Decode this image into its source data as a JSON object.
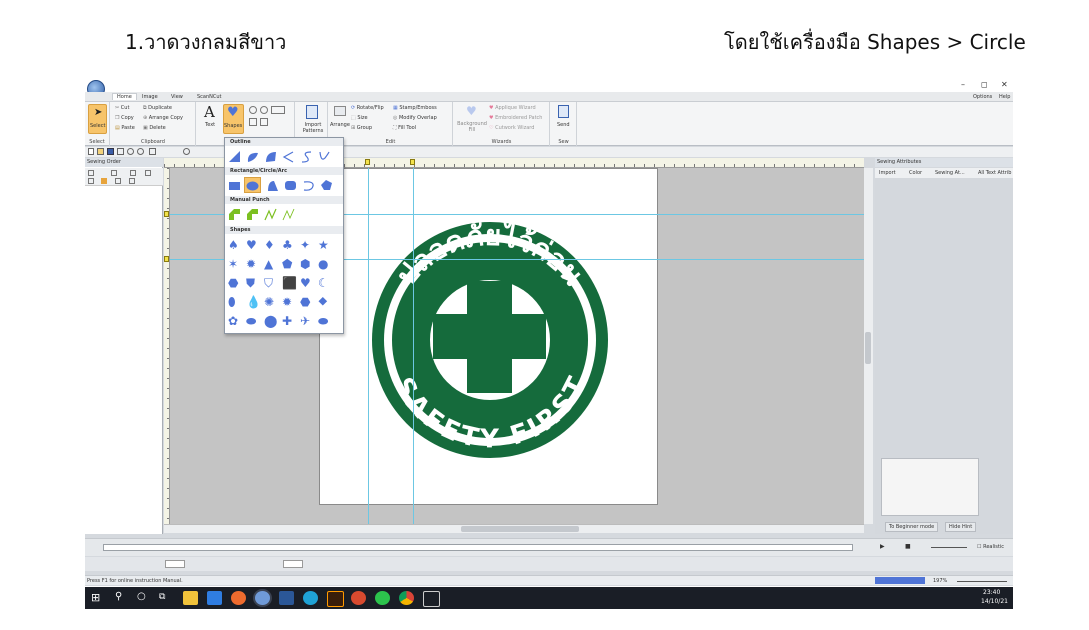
{
  "caption": {
    "left": "1.วาดวงกลมสีขาว",
    "right": "โดยใช้เครื่องมือ Shapes > Circle"
  },
  "window": {
    "minimize_glyph": "–",
    "maximize_glyph": "◻",
    "close_glyph": "✕",
    "options_label": "Options",
    "help_label": "Help"
  },
  "menu": {
    "tabs": [
      "Home",
      "Image",
      "View",
      "ScanNCut"
    ]
  },
  "ribbon": {
    "select_label": "Select",
    "cut_label": "Cut",
    "copy_label": "Copy",
    "paste_label": "Paste",
    "duplicate_label": "Duplicate",
    "arrange_copy_label": "Arrange Copy",
    "delete_label": "Delete",
    "text_label": "Text",
    "shapes_label": "Shapes",
    "import_patterns_label": "Import Patterns",
    "arrange_label": "Arrange",
    "rotate_flip_label": "Rotate/Flip",
    "size_label": "Size",
    "group_label": "Group",
    "stamp_emboss_label": "Stamp/Emboss",
    "modify_overlap_label": "Modify Overlap",
    "fill_tool_label": "Fill Tool",
    "background_fill_label": "Background Fill",
    "applique_wizard_label": "Applique Wizard",
    "embroidered_patch_label": "Embroidered Patch",
    "cutwork_wizard_label": "Cutwork Wizard",
    "send_label": "Send",
    "groups": {
      "select": "Select",
      "clipboard": "Clipboard",
      "edit": "Edit",
      "wizards": "Wizards",
      "sew": "Sew"
    }
  },
  "left_panel": {
    "title": "Sewing Order"
  },
  "right_panel": {
    "title": "Sewing Attributes",
    "tabs": [
      "Import",
      "Color",
      "Sewing At...",
      "All Text Attrib"
    ],
    "to_beginner_mode": "To Beginner mode",
    "hide_hint": "Hide Hint"
  },
  "dropdown": {
    "sections": [
      "Outline",
      "Rectangle/Circle/Arc",
      "Manual Punch",
      "Shapes"
    ]
  },
  "logo": {
    "thai_text": "ปลอดภัยไว้ก่อน",
    "english_text": "SAFETY FIRST",
    "color": "#156b3c"
  },
  "statusbar": {
    "hint": "Press F1 for online instruction Manual.",
    "zoom": "197%"
  },
  "timeline": {
    "realistic_label": "Realistic"
  },
  "taskbar": {
    "time": "23:40",
    "date": "14/10/21"
  },
  "colors": {
    "accent_orange": "#f7c46a",
    "shape_blue": "#4f74d6",
    "punch_green": "#7cc021"
  }
}
